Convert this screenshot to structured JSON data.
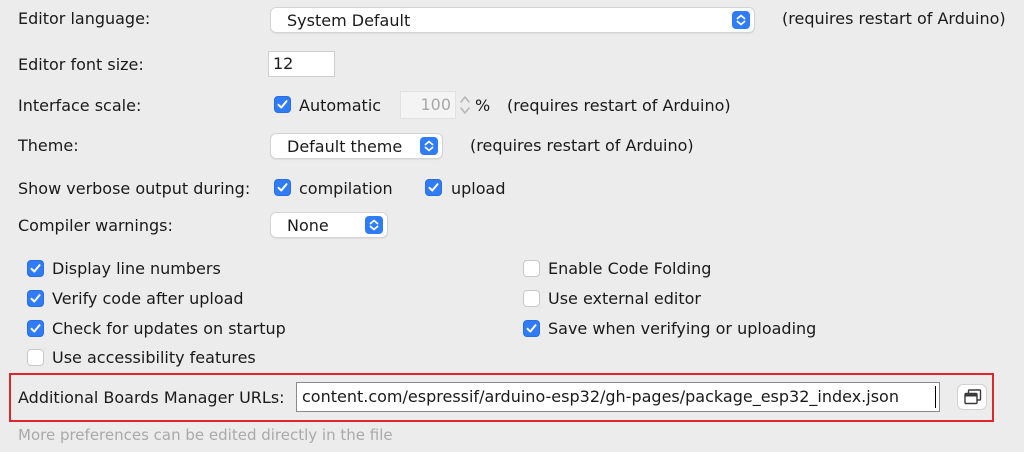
{
  "rows": {
    "editor_language": {
      "label": "Editor language:",
      "value": "System Default",
      "note": "(requires restart of Arduino)"
    },
    "editor_font_size": {
      "label": "Editor font size:",
      "value": "12"
    },
    "interface_scale": {
      "label": "Interface scale:",
      "automatic_label": "Automatic",
      "automatic_checked": true,
      "percent_value": "100",
      "percent_sign": "%",
      "note": "(requires restart of Arduino)"
    },
    "theme": {
      "label": "Theme:",
      "value": "Default theme",
      "note": "(requires restart of Arduino)"
    },
    "verbose": {
      "label": "Show verbose output during:",
      "compilation_label": "compilation",
      "compilation_checked": true,
      "upload_label": "upload",
      "upload_checked": true
    },
    "compiler_warnings": {
      "label": "Compiler warnings:",
      "value": "None"
    }
  },
  "options": [
    {
      "label": "Display line numbers",
      "checked": true
    },
    {
      "label": "Enable Code Folding",
      "checked": false
    },
    {
      "label": "Verify code after upload",
      "checked": true
    },
    {
      "label": "Use external editor",
      "checked": false
    },
    {
      "label": "Check for updates on startup",
      "checked": true
    },
    {
      "label": "Save when verifying or uploading",
      "checked": true
    },
    {
      "label": "Use accessibility features",
      "checked": false
    }
  ],
  "boards_manager": {
    "label": "Additional Boards Manager URLs:",
    "value": "content.com/espressif/arduino-esp32/gh-pages/package_esp32_index.json"
  },
  "footer": {
    "text": "More preferences can be edited directly in the file"
  },
  "colors": {
    "accent": "#2f7cf6",
    "highlight": "#e0262d",
    "background": "#ececec"
  },
  "icons": {
    "select_arrows": "chevron-up-down-icon",
    "checkmark": "checkmark-icon",
    "window_button": "open-window-icon"
  }
}
